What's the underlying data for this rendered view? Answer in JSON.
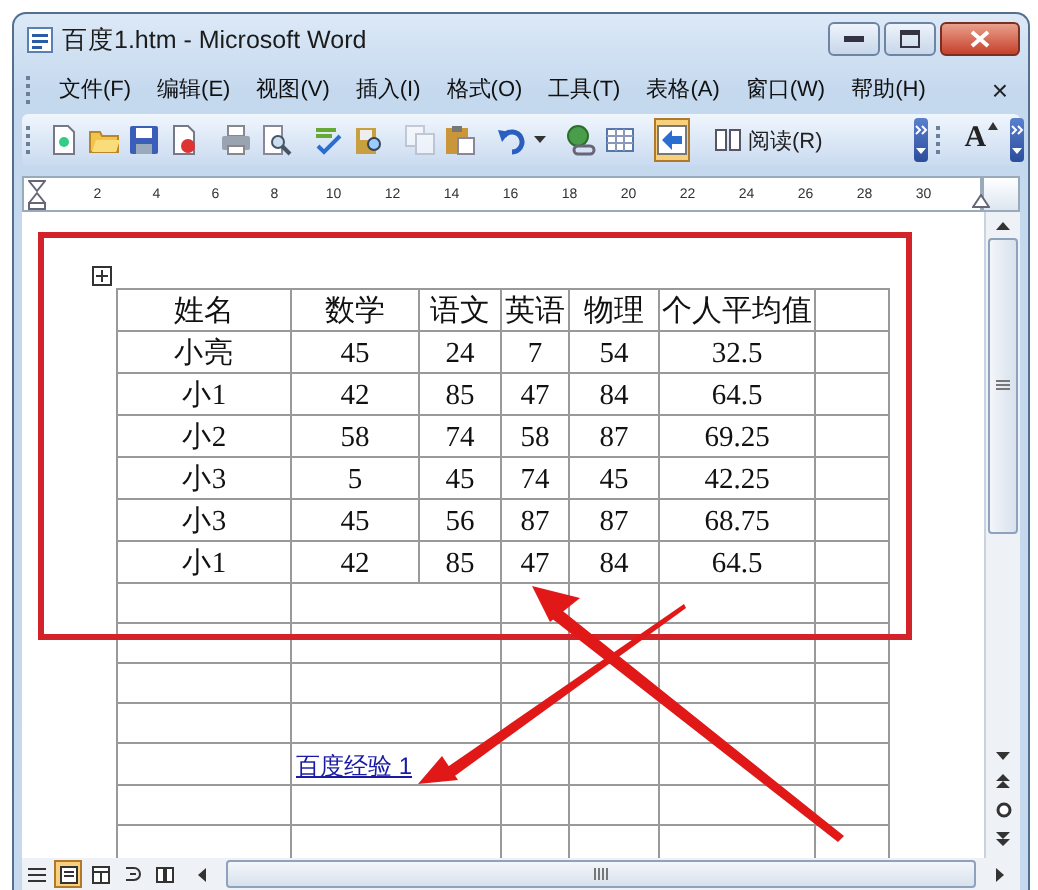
{
  "window": {
    "title": "百度1.htm - Microsoft Word"
  },
  "menu": [
    "文件(F)",
    "编辑(E)",
    "视图(V)",
    "插入(I)",
    "格式(O)",
    "工具(T)",
    "表格(A)",
    "窗口(W)",
    "帮助(H)"
  ],
  "menu_close": "×",
  "toolbar": {
    "map_button": {
      "selected": true
    },
    "read_button": {
      "label": "阅读(R)"
    },
    "grow_font_button": {
      "label": "A"
    }
  },
  "ruler": [
    "2",
    "4",
    "6",
    "8",
    "10",
    "12",
    "14",
    "16",
    "18",
    "20",
    "22",
    "24",
    "26",
    "28",
    "30"
  ],
  "table": {
    "columns": [
      "姓名",
      "数学",
      "语文",
      "英语",
      "物理",
      "个人平均值"
    ],
    "rows": [
      [
        "小亮",
        "45",
        "24",
        "7",
        "54",
        "32.5"
      ],
      [
        "小1",
        "42",
        "85",
        "47",
        "84",
        "64.5"
      ],
      [
        "小2",
        "58",
        "74",
        "58",
        "87",
        "69.25"
      ],
      [
        "小3",
        "5",
        "45",
        "74",
        "45",
        "42.25"
      ],
      [
        "小3",
        "45",
        "56",
        "87",
        "87",
        "68.75"
      ],
      [
        "小1",
        "42",
        "85",
        "47",
        "84",
        "64.5"
      ]
    ]
  },
  "link": "百度经验 1",
  "view_buttons": [
    {
      "selected": false
    },
    {
      "selected": true
    },
    {
      "selected": false
    },
    {
      "selected": false
    },
    {
      "selected": false
    }
  ]
}
